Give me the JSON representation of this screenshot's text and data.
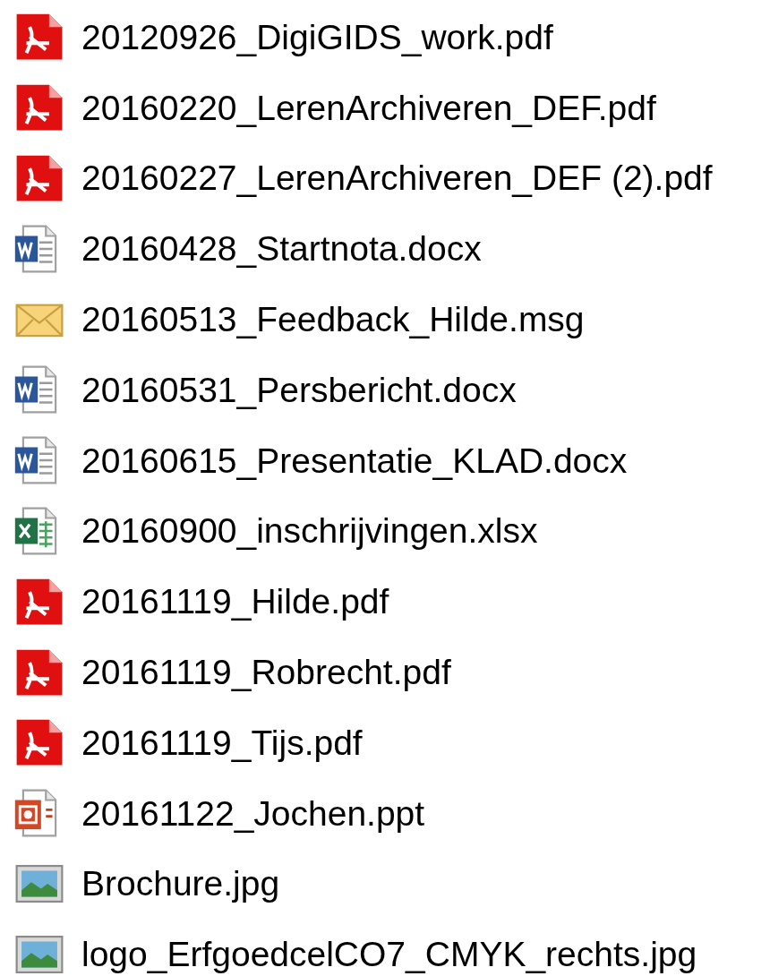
{
  "files": [
    {
      "name": "20120926_DigiGIDS_work.pdf",
      "kind": "pdf"
    },
    {
      "name": "20160220_LerenArchiveren_DEF.pdf",
      "kind": "pdf"
    },
    {
      "name": "20160227_LerenArchiveren_DEF (2).pdf",
      "kind": "pdf"
    },
    {
      "name": "20160428_Startnota.docx",
      "kind": "word"
    },
    {
      "name": "20160513_Feedback_Hilde.msg",
      "kind": "mail"
    },
    {
      "name": "20160531_Persbericht.docx",
      "kind": "word"
    },
    {
      "name": "20160615_Presentatie_KLAD.docx",
      "kind": "word"
    },
    {
      "name": "20160900_inschrijvingen.xlsx",
      "kind": "excel"
    },
    {
      "name": "20161119_Hilde.pdf",
      "kind": "pdf"
    },
    {
      "name": "20161119_Robrecht.pdf",
      "kind": "pdf"
    },
    {
      "name": "20161119_Tijs.pdf",
      "kind": "pdf"
    },
    {
      "name": "20161122_Jochen.ppt",
      "kind": "ppt"
    },
    {
      "name": "Brochure.jpg",
      "kind": "image"
    },
    {
      "name": "logo_ErfgoedcelCO7_CMYK_rechts.jpg",
      "kind": "image"
    }
  ]
}
